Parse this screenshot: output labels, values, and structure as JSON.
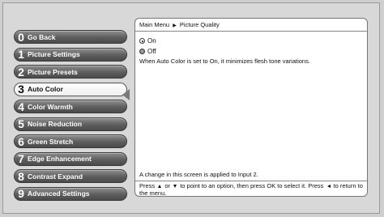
{
  "menu": {
    "items": [
      {
        "num": "0",
        "label": "Go Back"
      },
      {
        "num": "1",
        "label": "Picture Settings"
      },
      {
        "num": "2",
        "label": "Picture Presets"
      },
      {
        "num": "3",
        "label": "Auto Color"
      },
      {
        "num": "4",
        "label": "Color Warmth"
      },
      {
        "num": "5",
        "label": "Noise Reduction"
      },
      {
        "num": "6",
        "label": "Green Stretch"
      },
      {
        "num": "7",
        "label": "Edge Enhancement"
      },
      {
        "num": "8",
        "label": "Contrast Expand"
      },
      {
        "num": "9",
        "label": "Advanced Settings"
      }
    ],
    "active_index": 3
  },
  "panel": {
    "breadcrumb": {
      "root": "Main Menu",
      "separator": "▶",
      "current": "Picture Quality"
    },
    "options": [
      {
        "label": "On",
        "selected": true
      },
      {
        "label": "Off",
        "selected": false
      }
    ],
    "description": "When Auto Color is set to On, it minimizes flesh tone variations.",
    "footer_note": "A change in this screen is applied to Input 2.",
    "help": {
      "part1": "Press",
      "part2": "or",
      "part3": "to point to an option, then press OK to select it. Press",
      "part4": "to return to the menu."
    }
  },
  "colors": {
    "menu_item": "#5e5e5e",
    "menu_item_active": "#ffffff",
    "panel_bg": "#ffffff",
    "screen_bg": "#cfcfcf"
  }
}
